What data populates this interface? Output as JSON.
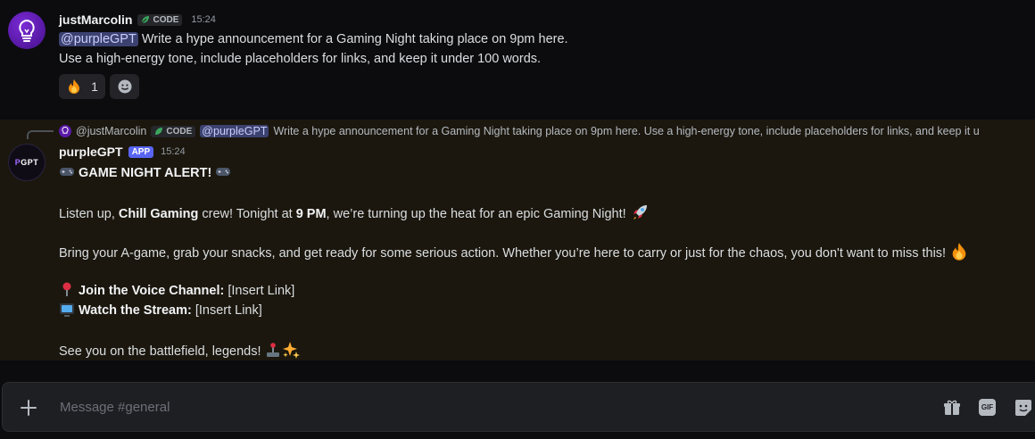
{
  "message1": {
    "author": "justMarcolin",
    "badge": "CODE",
    "time": "15:24",
    "mention": "@purpleGPT",
    "line1": "Write a hype announcement for a Gaming Night taking place on 9pm here.",
    "line2": "Use a high-energy tone, include placeholders for links, and keep it under 100 words.",
    "reaction_count": "1"
  },
  "reply_preview": {
    "author": "@justMarcolin",
    "badge": "CODE",
    "mention": "@purpleGPT",
    "text": "Write a hype announcement for a Gaming Night taking place on 9pm here.  Use a high-energy tone, include placeholders for links, and keep it u"
  },
  "message2": {
    "author": "purpleGPT",
    "avatar_text_p": "P",
    "avatar_text_rest": "GPT",
    "badge": "APP",
    "time": "15:24",
    "heading": "GAME NIGHT ALERT!",
    "p1_pre": "Listen up, ",
    "p1_bold1": "Chill Gaming",
    "p1_mid": " crew! Tonight at ",
    "p1_bold2": "9 PM",
    "p1_post": ", we’re turning up the heat for an epic Gaming Night!",
    "p2": "Bring your A-game, grab your snacks, and get ready for some serious action. Whether you’re here to carry or just for the chaos, you don't want to miss this!",
    "join_label": "Join the Voice Channel:",
    "join_link": "[Insert Link]",
    "stream_label": "Watch the Stream:",
    "stream_link": "[Insert Link]",
    "closing": "See you on the battlefield, legends!"
  },
  "composer": {
    "placeholder": "Message #general",
    "gif_label": "GIF"
  },
  "icons": [
    "lightbulb-avatar",
    "leaf-icon",
    "fire-emoji",
    "add-reaction-icon",
    "gamepad-emoji",
    "rocket-emoji",
    "pin-emoji",
    "tv-emoji",
    "joystick-emoji",
    "sparkles-emoji",
    "plus-icon",
    "gift-icon",
    "gif-icon",
    "sticker-icon"
  ],
  "colors": {
    "mention_bg": "#3c4270",
    "app_badge": "#5865f2",
    "highlight_bg": "#1b170e",
    "avatar_purple": "#5a1aa8"
  }
}
